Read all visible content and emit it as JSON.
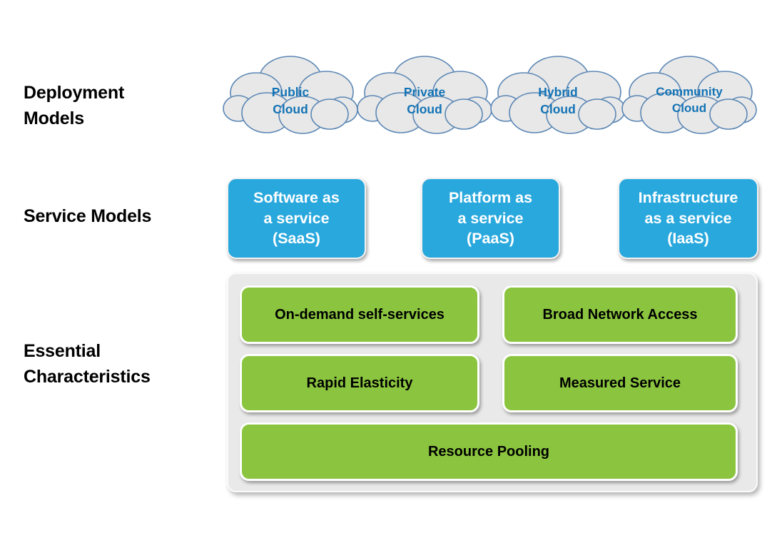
{
  "rows": {
    "deployment_label": "Deployment\nModels",
    "service_label": "Service Models",
    "essential_label": "Essential\nCharacteristics"
  },
  "colors": {
    "cloud_fill": "#e8e8e8",
    "cloud_stroke": "#5b87b5",
    "cloud_text": "#1273b5",
    "service_blue": "#29a8dd",
    "characteristic_green": "#8bc53f",
    "panel_gray": "#e9e9e9",
    "label_black": "#000000"
  },
  "deployment_models": [
    {
      "name": "public-cloud",
      "label": "Public\nCloud"
    },
    {
      "name": "private-cloud",
      "label": "Private\nCloud"
    },
    {
      "name": "hybrid-cloud",
      "label": "Hybrid\nCloud"
    },
    {
      "name": "community-cloud",
      "label": "Community\nCloud"
    }
  ],
  "service_models": [
    {
      "name": "saas",
      "label": "Software as\na service\n(SaaS)"
    },
    {
      "name": "paas",
      "label": "Platform as\na service\n(PaaS)"
    },
    {
      "name": "iaas",
      "label": "Infrastructure\nas a service\n(IaaS)"
    }
  ],
  "essential_characteristics": [
    {
      "name": "on-demand-self-services",
      "label": "On-demand self-services"
    },
    {
      "name": "broad-network-access",
      "label": "Broad Network Access"
    },
    {
      "name": "rapid-elasticity",
      "label": "Rapid Elasticity"
    },
    {
      "name": "measured-service",
      "label": "Measured Service"
    },
    {
      "name": "resource-pooling",
      "label": "Resource Pooling"
    }
  ]
}
